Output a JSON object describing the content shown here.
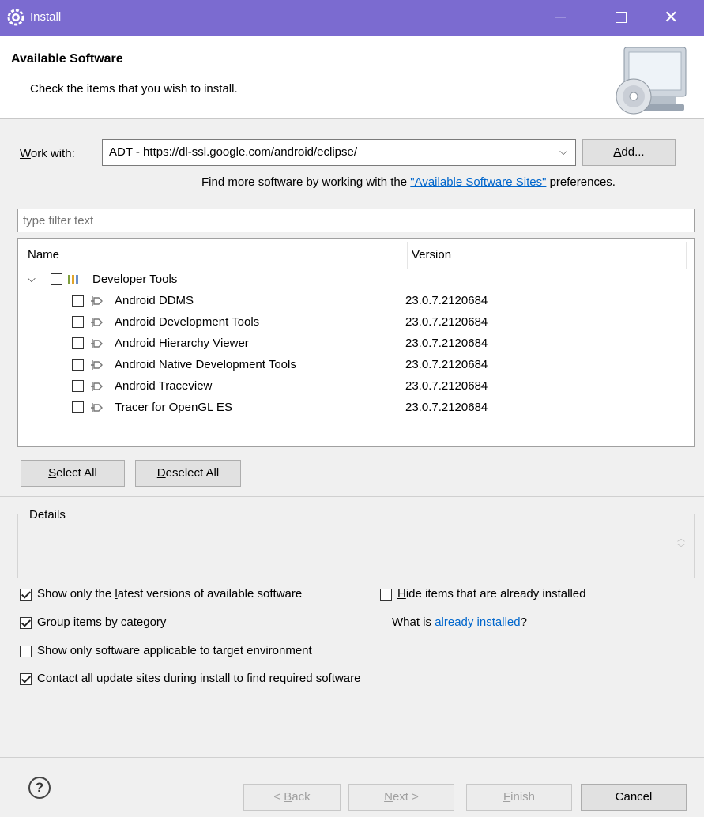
{
  "window": {
    "title": "Install"
  },
  "header": {
    "title": "Available Software",
    "subtitle": "Check the items that you wish to install."
  },
  "work_with": {
    "label_prefix": "W",
    "label_rest": "ork with:",
    "value": "ADT - https://dl-ssl.google.com/android/eclipse/",
    "add_prefix": "A",
    "add_rest": "dd..."
  },
  "find_more": {
    "before": "Find more software by working with the ",
    "link": "\"Available Software Sites\"",
    "after": " preferences."
  },
  "filter": {
    "placeholder": "type filter text"
  },
  "tree": {
    "columns": [
      "Name",
      "Version"
    ],
    "category": {
      "label": "Developer Tools",
      "checked": false
    },
    "items": [
      {
        "name": "Android DDMS",
        "version": "23.0.7.2120684"
      },
      {
        "name": "Android Development Tools",
        "version": "23.0.7.2120684"
      },
      {
        "name": "Android Hierarchy Viewer",
        "version": "23.0.7.2120684"
      },
      {
        "name": "Android Native Development Tools",
        "version": "23.0.7.2120684"
      },
      {
        "name": "Android Traceview",
        "version": "23.0.7.2120684"
      },
      {
        "name": "Tracer for OpenGL ES",
        "version": "23.0.7.2120684"
      }
    ]
  },
  "buttons": {
    "select_all_prefix": "S",
    "select_all_rest": "elect All",
    "deselect_all_prefix": "D",
    "deselect_all_rest": "eselect All"
  },
  "details": {
    "label": "Details"
  },
  "options": {
    "latest_a": "Show only the ",
    "latest_m": "l",
    "latest_b": "atest versions of available software",
    "group_m": "G",
    "group_b": "roup items by category",
    "target": "Show only software applicable to target environment",
    "contact_m": "C",
    "contact_b": "ontact all update sites during install to find required software",
    "hide_m": "H",
    "hide_b": "ide items that are already installed",
    "what_before": "What is ",
    "what_link": "already installed",
    "what_after": "?"
  },
  "footer": {
    "back_a": "< ",
    "back_m": "B",
    "back_b": "ack",
    "next_m": "N",
    "next_b": "ext >",
    "finish_m": "F",
    "finish_b": "inish",
    "cancel": "Cancel"
  }
}
